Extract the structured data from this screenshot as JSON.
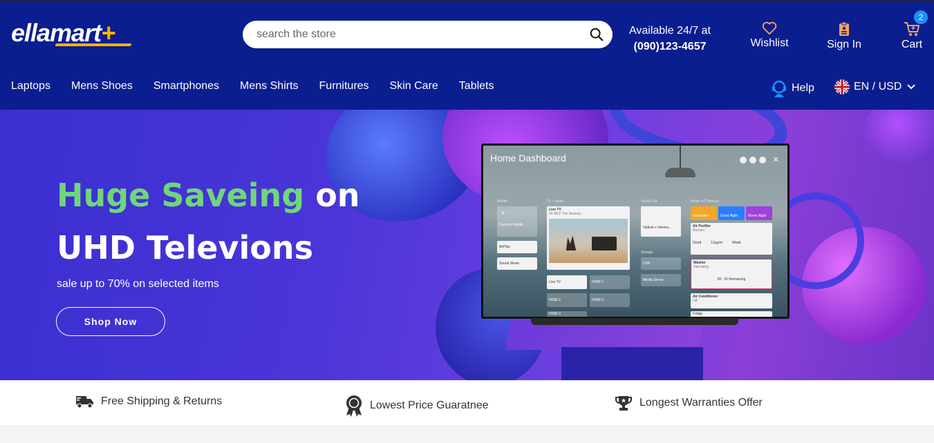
{
  "brand": {
    "name": "ellamart",
    "plus": "+"
  },
  "search": {
    "placeholder": "search the store"
  },
  "contact": {
    "line1": "Available 24/7 at",
    "phone": "(090)123-4657"
  },
  "header_actions": {
    "wishlist": "Wishlist",
    "signin": "Sign In",
    "cart": "Cart",
    "cart_count": "2"
  },
  "nav": {
    "items": [
      "Laptops",
      "Mens Shoes",
      "Smartphones",
      "Mens Shirts",
      "Furnitures",
      "Skin Care",
      "Tablets"
    ]
  },
  "help": {
    "label": "Help"
  },
  "locale": {
    "label": "EN / USD"
  },
  "hero": {
    "headline_green": "Huge Saveing",
    "headline_rest": " on",
    "headline_line2": "UHD Televions",
    "subtext": "sale up to 70% on selected items",
    "cta": "Shop Now"
  },
  "tv": {
    "title": "Home Dashboard",
    "columns": [
      "Mobile",
      "TV / Inputs",
      "Sound Out",
      "Home IoT Devices"
    ],
    "connect_mobile": "Connect Mobile ...",
    "airplay": "AirPlay",
    "sound_share": "Sound Share",
    "live_tv": "Live TV",
    "live_tv_sub": "20 SKD The Journey",
    "live_tv_2": "Live TV",
    "hdmi1": "HDMI 1",
    "hdmi2": "HDMI 2",
    "hdmi3": "HDMI 3",
    "hdmi4": "HDMI 4",
    "optical": "Optical + Interna...",
    "storage": "Storage",
    "usb": "USB",
    "media_server": "Media Server",
    "good_morn": "Good Morn",
    "good_night": "Good Night",
    "movie_night": "Movie Night",
    "air_purifier": "Air Purifier",
    "air_purifier_sub": "Booster",
    "good": "Good",
    "good2": "12µg/m",
    "weak": "Weak",
    "washer": "Washer",
    "washer_sub": "Operating",
    "remaining": "00 : 20 Remaining",
    "air_conditioner": "Air Conditioner",
    "ac_sub": "Off",
    "fridge": "Fridge"
  },
  "features": [
    {
      "label": "Free Shipping & Returns",
      "icon": "truck-icon"
    },
    {
      "label": "Lowest Price Guaratnee",
      "icon": "award-icon"
    },
    {
      "label": "Longest Warranties Offer",
      "icon": "trophy-icon"
    }
  ],
  "colors": {
    "header_bg": "#0b1e8f",
    "accent_yellow": "#f7b500",
    "accent_green": "#6fd77a",
    "badge_blue": "#1e8fff",
    "wishlist_orange": "#f7a35c"
  }
}
